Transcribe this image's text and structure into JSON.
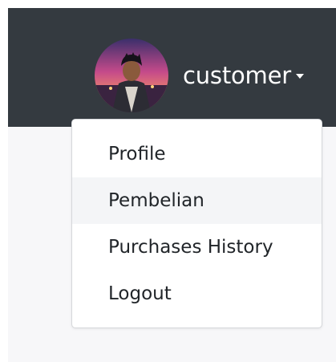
{
  "navbar": {
    "username": "customer",
    "colors": {
      "background": "#343a40",
      "text": "#ffffff"
    }
  },
  "dropdown": {
    "items": [
      {
        "label": "Profile",
        "active": false
      },
      {
        "label": "Pembelian",
        "active": true
      },
      {
        "label": "Purchases History",
        "active": false
      },
      {
        "label": "Logout",
        "active": false
      }
    ],
    "colors": {
      "hover_background": "#f4f5f7",
      "text": "#212529",
      "border": "#d6d8db"
    }
  },
  "icons": {
    "avatar": "user-avatar-photo",
    "caret": "caret-down-icon"
  }
}
